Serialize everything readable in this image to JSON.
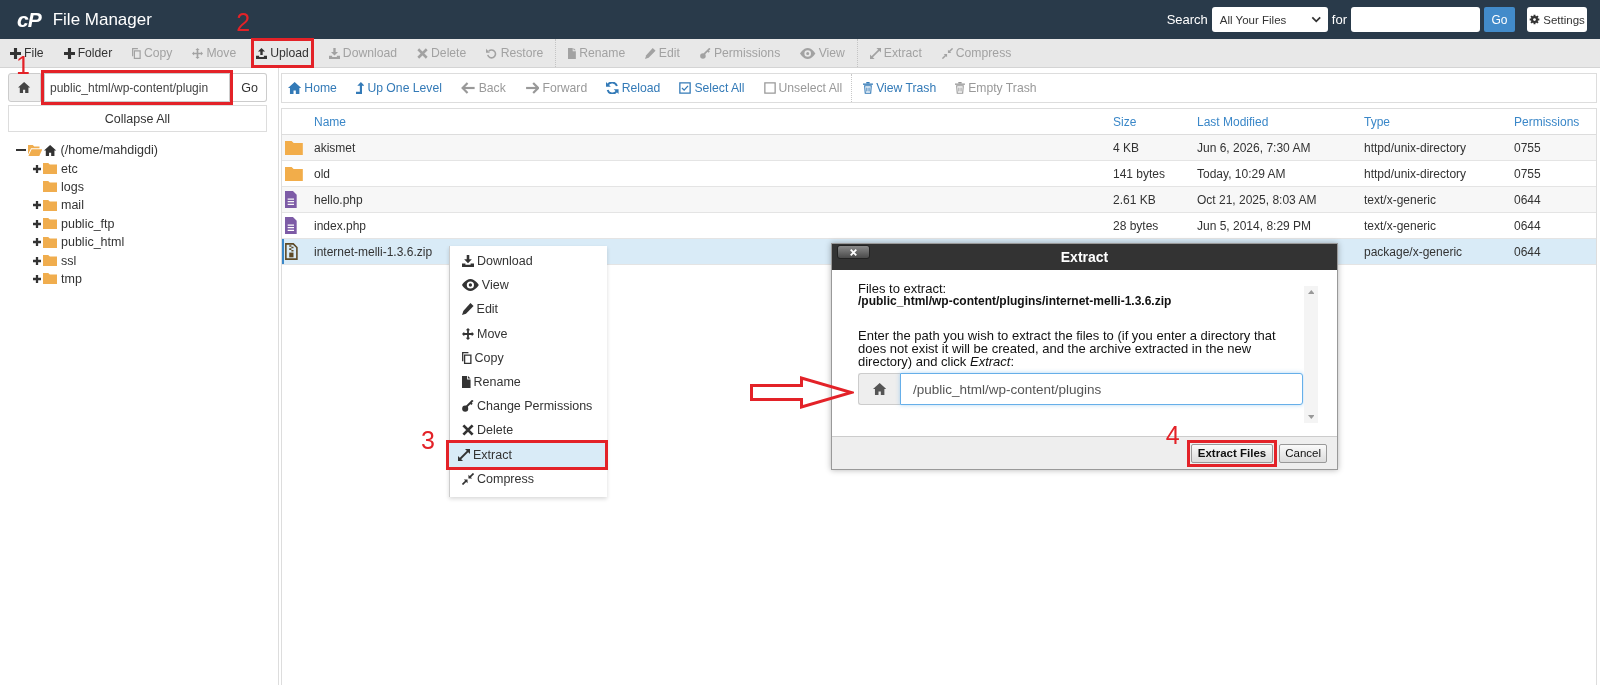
{
  "header": {
    "logo": "cP",
    "title": "File Manager",
    "search": {
      "label": "Search",
      "scope": "All Your Files",
      "for_label": "for",
      "button": "Go"
    },
    "settings_button": "Settings"
  },
  "toolbar": {
    "groups": [
      {
        "items": [
          {
            "label": "File",
            "disabled": false,
            "highlighted": false
          },
          {
            "label": "Folder",
            "disabled": false,
            "highlighted": false
          },
          {
            "label": "Copy",
            "disabled": true,
            "highlighted": false
          },
          {
            "label": "Move",
            "disabled": true,
            "highlighted": false
          },
          {
            "label": "Upload",
            "disabled": false,
            "highlighted": true,
            "callout": "2"
          },
          {
            "label": "Download",
            "disabled": true,
            "highlighted": false
          },
          {
            "label": "Delete",
            "disabled": true,
            "highlighted": false
          },
          {
            "label": "Restore",
            "disabled": true,
            "highlighted": false
          }
        ]
      },
      {
        "items": [
          {
            "label": "Rename",
            "disabled": true,
            "highlighted": false
          },
          {
            "label": "Edit",
            "disabled": true,
            "highlighted": false
          },
          {
            "label": "Permissions",
            "disabled": true,
            "highlighted": false
          },
          {
            "label": "View",
            "disabled": true,
            "highlighted": false
          }
        ]
      },
      {
        "items": [
          {
            "label": "Extract",
            "disabled": true,
            "highlighted": false
          },
          {
            "label": "Compress",
            "disabled": true,
            "highlighted": false
          }
        ]
      }
    ]
  },
  "sidebar": {
    "path_bar": {
      "value": "public_html/wp-content/plugin",
      "button": "Go",
      "highlighted": true,
      "callout": "1"
    },
    "collapse_button": "Collapse All",
    "tree": {
      "label": "(/home/mahdigdi)",
      "expanded": true,
      "children": [
        {
          "label": "etc",
          "expandable": true,
          "expanded": false
        },
        {
          "label": "logs",
          "expandable": false
        },
        {
          "label": "mail",
          "expandable": true,
          "expanded": false
        },
        {
          "label": "public_ftp",
          "expandable": true,
          "expanded": false
        },
        {
          "label": "public_html",
          "expandable": true,
          "expanded": false
        },
        {
          "label": "ssl",
          "expandable": true,
          "expanded": false
        },
        {
          "label": "tmp",
          "expandable": true,
          "expanded": false
        }
      ]
    }
  },
  "navbar": {
    "groups": [
      {
        "items": [
          {
            "label": "Home",
            "disabled": false
          },
          {
            "label": "Up One Level",
            "disabled": false
          },
          {
            "label": "Back",
            "disabled": true
          },
          {
            "label": "Forward",
            "disabled": true
          },
          {
            "label": "Reload",
            "disabled": false
          },
          {
            "label": "Select All",
            "disabled": false
          },
          {
            "label": "Unselect All",
            "disabled": true
          }
        ]
      },
      {
        "items": [
          {
            "label": "View Trash",
            "disabled": false
          },
          {
            "label": "Empty Trash",
            "disabled": true
          }
        ]
      }
    ]
  },
  "table": {
    "columns": [
      "Name",
      "Size",
      "Last Modified",
      "Type",
      "Permissions"
    ],
    "rows": [
      {
        "kind": "folder",
        "name": "akismet",
        "size": "4 KB",
        "last_modified": "Jun 6, 2026, 7:30 AM",
        "type": "httpd/unix-directory",
        "permissions": "0755",
        "selected": false
      },
      {
        "kind": "folder",
        "name": "old",
        "size": "141 bytes",
        "last_modified": "Today, 10:29 AM",
        "type": "httpd/unix-directory",
        "permissions": "0755",
        "selected": false
      },
      {
        "kind": "file",
        "name": "hello.php",
        "size": "2.61 KB",
        "last_modified": "Oct 21, 2025, 8:03 AM",
        "type": "text/x-generic",
        "permissions": "0644",
        "selected": false
      },
      {
        "kind": "file",
        "name": "index.php",
        "size": "28 bytes",
        "last_modified": "Jun 5, 2014, 8:29 PM",
        "type": "text/x-generic",
        "permissions": "0644",
        "selected": false
      },
      {
        "kind": "archive",
        "name": "internet-melli-1.3.6.zip",
        "type": "package/x-generic",
        "permissions": "0644",
        "selected": true
      }
    ]
  },
  "context_menu": {
    "items": [
      {
        "label": "Download",
        "selected": false,
        "highlighted": false
      },
      {
        "label": "View",
        "selected": false,
        "highlighted": false
      },
      {
        "label": "Edit",
        "selected": false,
        "highlighted": false
      },
      {
        "label": "Move",
        "selected": false,
        "highlighted": false
      },
      {
        "label": "Copy",
        "selected": false,
        "highlighted": false
      },
      {
        "label": "Rename",
        "selected": false,
        "highlighted": false
      },
      {
        "label": "Change Permissions",
        "selected": false,
        "highlighted": false
      },
      {
        "label": "Delete",
        "selected": false,
        "highlighted": false
      },
      {
        "label": "Extract",
        "selected": true,
        "highlighted": true,
        "callout": "3"
      },
      {
        "label": "Compress",
        "selected": false,
        "highlighted": false
      }
    ]
  },
  "dialog": {
    "title": "Extract",
    "files_label": "Files to extract:",
    "files_path": "/public_html/wp-content/plugins/internet-melli-1.3.6.zip",
    "instruction": "Enter the path you wish to extract the files to (if you enter a directory that does not exist it will be created, and the archive extracted in the new directory) and click *Extract*:",
    "path_field": {
      "value": "/public_html/wp-content/plugins",
      "pointed_at": true
    },
    "buttons": [
      {
        "label": "Extract Files",
        "kind": "primary",
        "highlighted": true,
        "callout": "4"
      },
      {
        "label": "Cancel",
        "kind": "secondary",
        "highlighted": false
      }
    ]
  }
}
